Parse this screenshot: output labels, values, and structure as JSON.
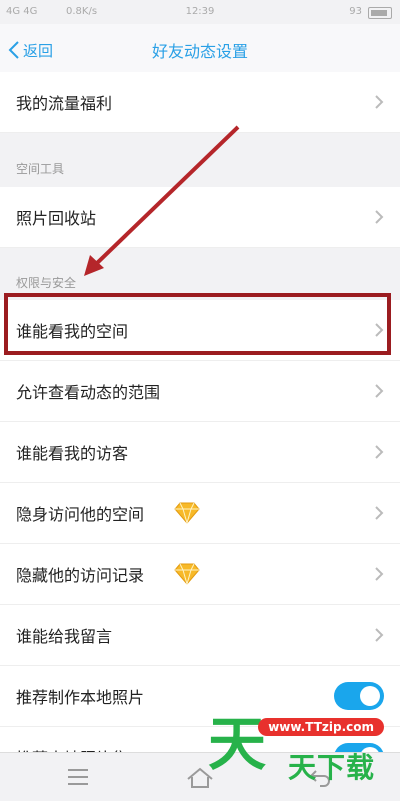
{
  "status": {
    "carrier": "4G  4G",
    "speed": "0.8K/s",
    "time": "12:39",
    "battery": "93"
  },
  "nav": {
    "back_label": "返回",
    "title": "好友动态设置"
  },
  "rows": {
    "traffic": "我的流量福利",
    "recycle": "照片回收站",
    "who_can_see_space": "谁能看我的空间",
    "allow_range": "允许查看动态的范围",
    "who_see_visitors": "谁能看我的访客",
    "invisible_visit": "隐身访问他的空间",
    "hide_records": "隐藏他的访问记录",
    "who_can_comment": "谁能给我留言",
    "recommend_photos": "推荐制作本地照片",
    "recommend_album": "推荐本地照片集"
  },
  "sections": {
    "space_tools": "空间工具",
    "privacy": "权限与安全"
  },
  "toggles": {
    "recommend_photos_on": true,
    "recommend_album_on": true
  },
  "watermark": {
    "url": "www.TTzip.com",
    "big": "天",
    "small": "天下载"
  },
  "colors": {
    "accent": "#2aa0e6",
    "highlight": "#9b1c20",
    "toggle": "#1aa6ec"
  },
  "icons": {
    "back": "chevron-left-icon",
    "row_arrow": "chevron-right-icon",
    "gem": "diamond-icon"
  }
}
